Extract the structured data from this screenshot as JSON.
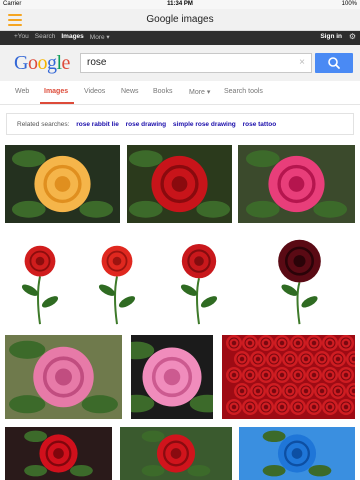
{
  "status": {
    "carrier": "Carrier",
    "time": "11:34 PM",
    "battery": "100%"
  },
  "titlebar": {
    "title": "Google images"
  },
  "gbar": {
    "links": [
      "+You",
      "Search",
      "Images",
      "More ▾"
    ],
    "active_index": 2,
    "signin": "Sign in"
  },
  "search": {
    "query": "rose",
    "clear_glyph": "×",
    "logo": [
      "G",
      "o",
      "o",
      "g",
      "l",
      "e"
    ]
  },
  "tabs": [
    "Web",
    "Images",
    "Videos",
    "News",
    "Books",
    "More ▾",
    "Search tools"
  ],
  "related": {
    "label": "Related searches:",
    "items": [
      "rose rabbit lie",
      "rose drawing",
      "simple rose drawing",
      "rose tattoo"
    ]
  },
  "colors": {
    "accent": "#dd4b39",
    "search_button": "#4a8af4",
    "menu": "#f5a623"
  },
  "images": [
    {
      "name": "yellow-rose",
      "bg": "#24311f",
      "flower": "#f5b54a",
      "center": "#e08f1f"
    },
    {
      "name": "red-rose",
      "bg": "#2b3a1c",
      "flower": "#c8141a",
      "center": "#8a0a0e"
    },
    {
      "name": "pink-rose",
      "bg": "#3b4a2c",
      "flower": "#e83e7a",
      "center": "#b5154e"
    },
    {
      "name": "red-rose-stem-1",
      "bg": "#ffffff",
      "flower": "#d11d1d",
      "center": "#8c0d0d"
    },
    {
      "name": "red-rose-stem-2",
      "bg": "#ffffff",
      "flower": "#e0281f",
      "center": "#9c1410"
    },
    {
      "name": "red-rose-stem-3",
      "bg": "#ffffff",
      "flower": "#c9181c",
      "center": "#840c0f"
    },
    {
      "name": "dark-red-rose",
      "bg": "#ffffff",
      "flower": "#5a0a14",
      "center": "#2a0308"
    },
    {
      "name": "pink-garden-rose",
      "bg": "#6f7a4c",
      "flower": "#e77aa8",
      "center": "#c14d80"
    },
    {
      "name": "light-pink-rose",
      "bg": "#1b1b1b",
      "flower": "#f08cbc",
      "center": "#cc5a90"
    },
    {
      "name": "many-red-roses",
      "bg": "#9e0b14",
      "flower": "#cf1d22",
      "center": "#7a0810"
    },
    {
      "name": "red-rose-dark",
      "bg": "#2a1a1a",
      "flower": "#d0101c",
      "center": "#80060d"
    },
    {
      "name": "red-rose-leaves",
      "bg": "#3a5a2e",
      "flower": "#d0141c",
      "center": "#8a0b10"
    },
    {
      "name": "blue-rose",
      "bg": "#3a8fe0",
      "flower": "#1f76d8",
      "center": "#0d4fa3"
    }
  ]
}
